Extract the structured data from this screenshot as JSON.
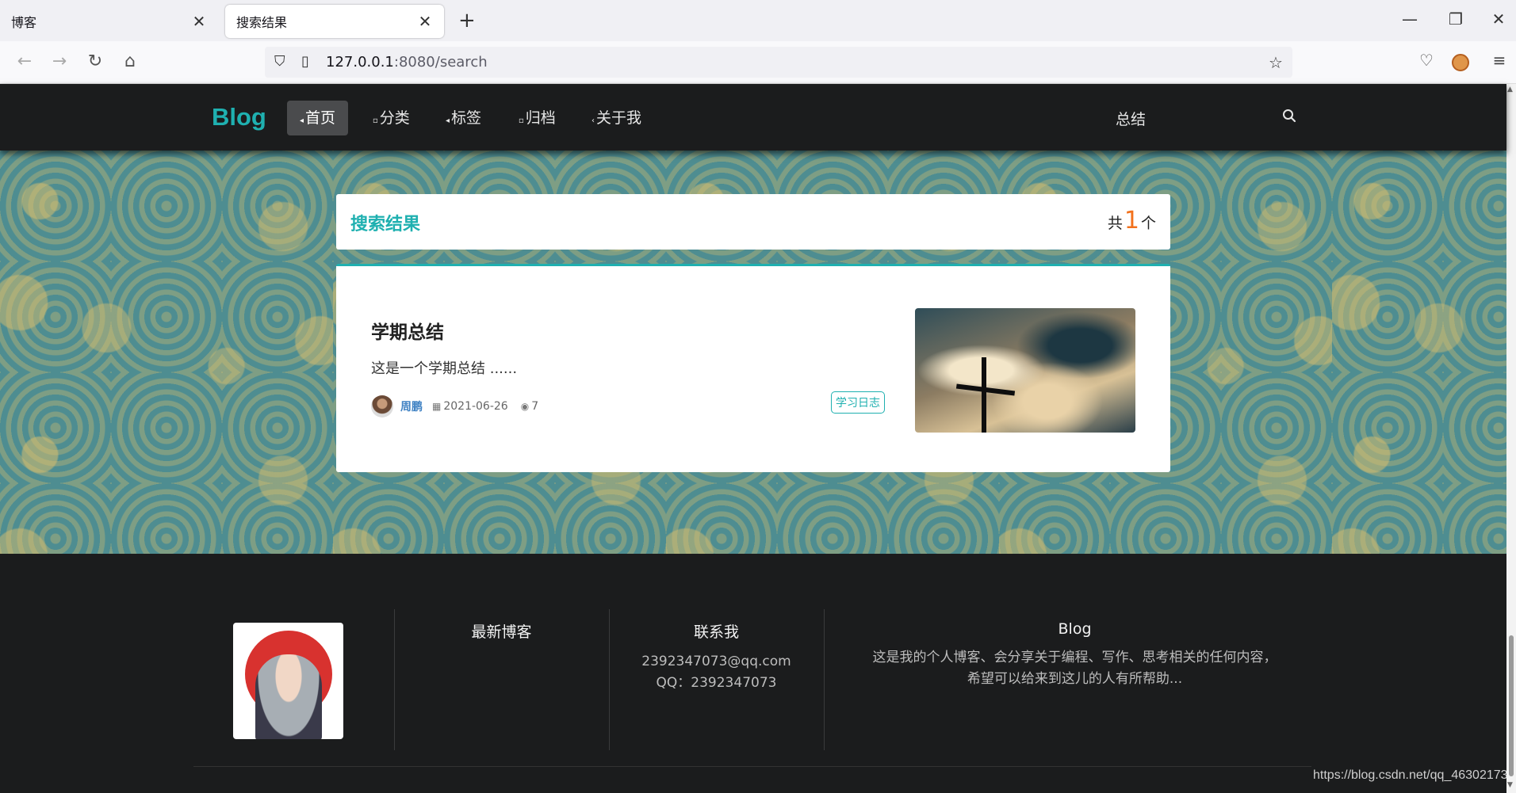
{
  "browser": {
    "tabs": [
      {
        "title": "博客",
        "close": "✕"
      },
      {
        "title": "搜索结果",
        "close": "✕"
      }
    ],
    "new_tab": "+",
    "window_controls": {
      "minimize": "—",
      "restore": "❐",
      "close": "✕"
    },
    "url_host": "127.0.0.1",
    "url_path": ":8080/search"
  },
  "site": {
    "logo": "Blog",
    "menu": [
      {
        "label": "首页",
        "active": true
      },
      {
        "label": "分类",
        "active": false
      },
      {
        "label": "标签",
        "active": false
      },
      {
        "label": "归档",
        "active": false
      },
      {
        "label": "关于我",
        "active": false
      }
    ],
    "header_right": "总结"
  },
  "search": {
    "title": "搜索结果",
    "count_prefix": "共",
    "count": "1",
    "count_suffix": "个"
  },
  "results": [
    {
      "title": "学期总结",
      "excerpt": "这是一个学期总结 ......",
      "author": "周鹏",
      "date": "2021-06-26",
      "views": "7",
      "tag": "学习日志"
    }
  ],
  "footer": {
    "latest_heading": "最新博客",
    "contact_heading": "联系我",
    "email": "2392347073@qq.com",
    "qq": "QQ：2392347073",
    "blog_heading": "Blog",
    "blog_desc_line1": "这是我的个人博客、会分享关于编程、写作、思考相关的任何内容，",
    "blog_desc_line2": "希望可以给来到这儿的人有所帮助..."
  },
  "watermark": "https://blog.csdn.net/qq_46302173"
}
